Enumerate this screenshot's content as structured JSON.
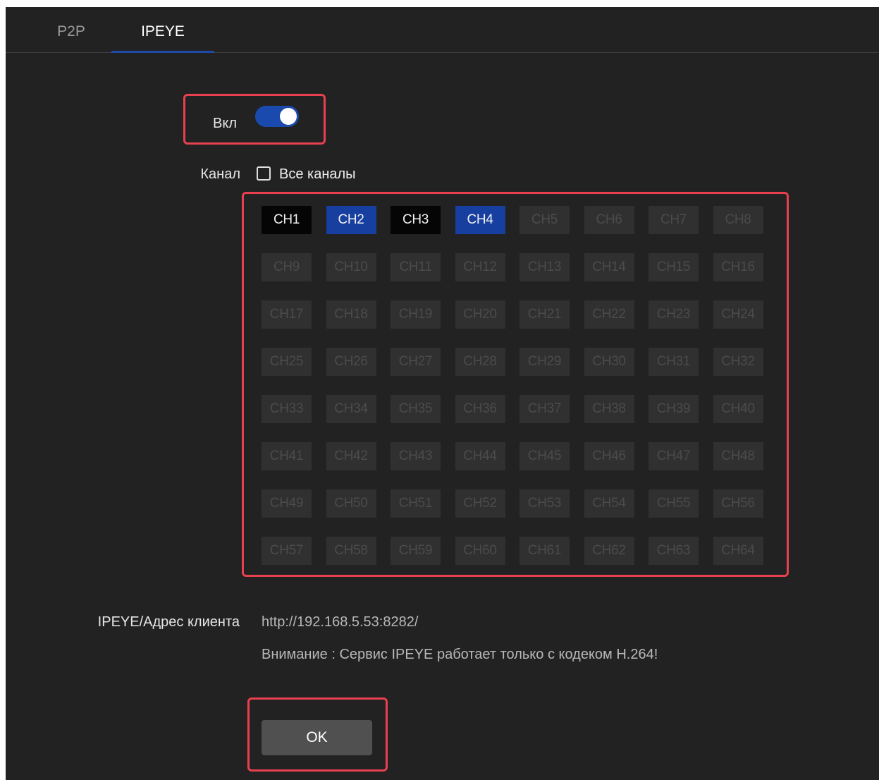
{
  "tabs": [
    {
      "label": "P2P",
      "active": false
    },
    {
      "label": "IPEYE",
      "active": true
    }
  ],
  "enable": {
    "label": "Вкл",
    "on": true
  },
  "channel": {
    "label": "Канал",
    "all_channels_label": "Все каналы",
    "all_channels_checked": false,
    "items": [
      {
        "label": "CH1",
        "state": "selected-black"
      },
      {
        "label": "CH2",
        "state": "selected-blue"
      },
      {
        "label": "CH3",
        "state": "selected-black"
      },
      {
        "label": "CH4",
        "state": "selected-blue"
      },
      {
        "label": "CH5",
        "state": "disabled"
      },
      {
        "label": "CH6",
        "state": "disabled"
      },
      {
        "label": "CH7",
        "state": "disabled"
      },
      {
        "label": "CH8",
        "state": "disabled"
      },
      {
        "label": "CH9",
        "state": "disabled"
      },
      {
        "label": "CH10",
        "state": "disabled"
      },
      {
        "label": "CH11",
        "state": "disabled"
      },
      {
        "label": "CH12",
        "state": "disabled"
      },
      {
        "label": "CH13",
        "state": "disabled"
      },
      {
        "label": "CH14",
        "state": "disabled"
      },
      {
        "label": "CH15",
        "state": "disabled"
      },
      {
        "label": "CH16",
        "state": "disabled"
      },
      {
        "label": "CH17",
        "state": "disabled"
      },
      {
        "label": "CH18",
        "state": "disabled"
      },
      {
        "label": "CH19",
        "state": "disabled"
      },
      {
        "label": "CH20",
        "state": "disabled"
      },
      {
        "label": "CH21",
        "state": "disabled"
      },
      {
        "label": "CH22",
        "state": "disabled"
      },
      {
        "label": "CH23",
        "state": "disabled"
      },
      {
        "label": "CH24",
        "state": "disabled"
      },
      {
        "label": "CH25",
        "state": "disabled"
      },
      {
        "label": "CH26",
        "state": "disabled"
      },
      {
        "label": "CH27",
        "state": "disabled"
      },
      {
        "label": "CH28",
        "state": "disabled"
      },
      {
        "label": "CH29",
        "state": "disabled"
      },
      {
        "label": "CH30",
        "state": "disabled"
      },
      {
        "label": "CH31",
        "state": "disabled"
      },
      {
        "label": "CH32",
        "state": "disabled"
      },
      {
        "label": "CH33",
        "state": "disabled"
      },
      {
        "label": "CH34",
        "state": "disabled"
      },
      {
        "label": "CH35",
        "state": "disabled"
      },
      {
        "label": "CH36",
        "state": "disabled"
      },
      {
        "label": "CH37",
        "state": "disabled"
      },
      {
        "label": "CH38",
        "state": "disabled"
      },
      {
        "label": "CH39",
        "state": "disabled"
      },
      {
        "label": "CH40",
        "state": "disabled"
      },
      {
        "label": "CH41",
        "state": "disabled"
      },
      {
        "label": "CH42",
        "state": "disabled"
      },
      {
        "label": "CH43",
        "state": "disabled"
      },
      {
        "label": "CH44",
        "state": "disabled"
      },
      {
        "label": "CH45",
        "state": "disabled"
      },
      {
        "label": "CH46",
        "state": "disabled"
      },
      {
        "label": "CH47",
        "state": "disabled"
      },
      {
        "label": "CH48",
        "state": "disabled"
      },
      {
        "label": "CH49",
        "state": "disabled"
      },
      {
        "label": "CH50",
        "state": "disabled"
      },
      {
        "label": "CH51",
        "state": "disabled"
      },
      {
        "label": "CH52",
        "state": "disabled"
      },
      {
        "label": "CH53",
        "state": "disabled"
      },
      {
        "label": "CH54",
        "state": "disabled"
      },
      {
        "label": "CH55",
        "state": "disabled"
      },
      {
        "label": "CH56",
        "state": "disabled"
      },
      {
        "label": "CH57",
        "state": "disabled"
      },
      {
        "label": "CH58",
        "state": "disabled"
      },
      {
        "label": "CH59",
        "state": "disabled"
      },
      {
        "label": "CH60",
        "state": "disabled"
      },
      {
        "label": "CH61",
        "state": "disabled"
      },
      {
        "label": "CH62",
        "state": "disabled"
      },
      {
        "label": "CH63",
        "state": "disabled"
      },
      {
        "label": "CH64",
        "state": "disabled"
      }
    ]
  },
  "client_address": {
    "label": "IPEYE/Адрес клиента",
    "url": "http://192.168.5.53:8282/",
    "warning": "Внимание : Сервис IPEYE работает только с кодеком H.264!"
  },
  "ok_button": {
    "label": "OK"
  },
  "colors": {
    "panel_bg": "#222222",
    "accent_blue": "#1a4aad",
    "highlight_red": "#e8404f",
    "channel_disabled_bg": "#303030"
  }
}
